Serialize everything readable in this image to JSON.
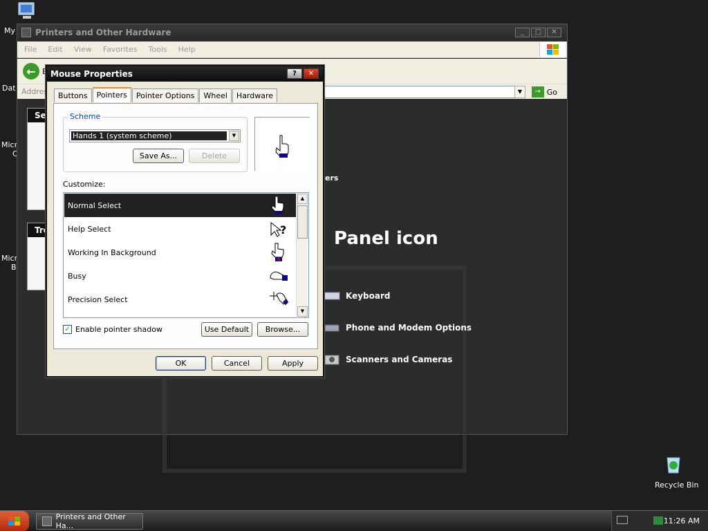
{
  "desktop": {
    "icons": [
      {
        "label": "My",
        "name": "my-computer"
      },
      {
        "label": "Dat",
        "name": "data-partial"
      },
      {
        "label": "Micr",
        "name": "micro-1-partial"
      },
      {
        "label": "Micr",
        "name": "micro-2-partial"
      },
      {
        "label": "C",
        "name": "micro-1-line2"
      },
      {
        "label": "B",
        "name": "micro-2-line2"
      },
      {
        "label": "Recycle Bin",
        "name": "recycle-bin"
      }
    ]
  },
  "explorer": {
    "title": "Printers and Other Hardware",
    "menu": [
      "File",
      "Edit",
      "View",
      "Favorites",
      "Tools",
      "Help"
    ],
    "back_label": "B",
    "address_label": "Address",
    "go_label": "Go",
    "side_headers": [
      "Se",
      "Tro"
    ],
    "ers_text": "ers",
    "panel_heading": "Panel icon",
    "items": [
      {
        "label": "Keyboard"
      },
      {
        "label": "Phone and Modem Options"
      },
      {
        "label": "Scanners and Cameras"
      }
    ]
  },
  "dialog": {
    "title": "Mouse Properties",
    "help_glyph": "?",
    "close_glyph": "✕",
    "tabs": [
      {
        "label": "Buttons",
        "active": false
      },
      {
        "label": "Pointers",
        "active": true
      },
      {
        "label": "Pointer Options",
        "active": false
      },
      {
        "label": "Wheel",
        "active": false
      },
      {
        "label": "Hardware",
        "active": false
      }
    ],
    "scheme": {
      "legend": "Scheme",
      "selected": "Hands 1 (system scheme)",
      "save_as_label": "Save As...",
      "delete_label": "Delete"
    },
    "customize_label": "Customize:",
    "cursors": [
      {
        "label": "Normal Select",
        "icon": "hand-pointer-icon",
        "selected": true
      },
      {
        "label": "Help Select",
        "icon": "help-pointer-icon",
        "selected": false
      },
      {
        "label": "Working In Background",
        "icon": "working-pointer-icon",
        "selected": false
      },
      {
        "label": "Busy",
        "icon": "busy-pointer-icon",
        "selected": false
      },
      {
        "label": "Precision Select",
        "icon": "precision-pointer-icon",
        "selected": false
      }
    ],
    "shadow_label": "Enable pointer shadow",
    "shadow_checked": true,
    "use_default_label": "Use Default",
    "browse_label": "Browse...",
    "ok_label": "OK",
    "cancel_label": "Cancel",
    "apply_label": "Apply"
  },
  "taskbar": {
    "task_label": "Printers and Other Ha...",
    "clock": "11:26 AM"
  }
}
